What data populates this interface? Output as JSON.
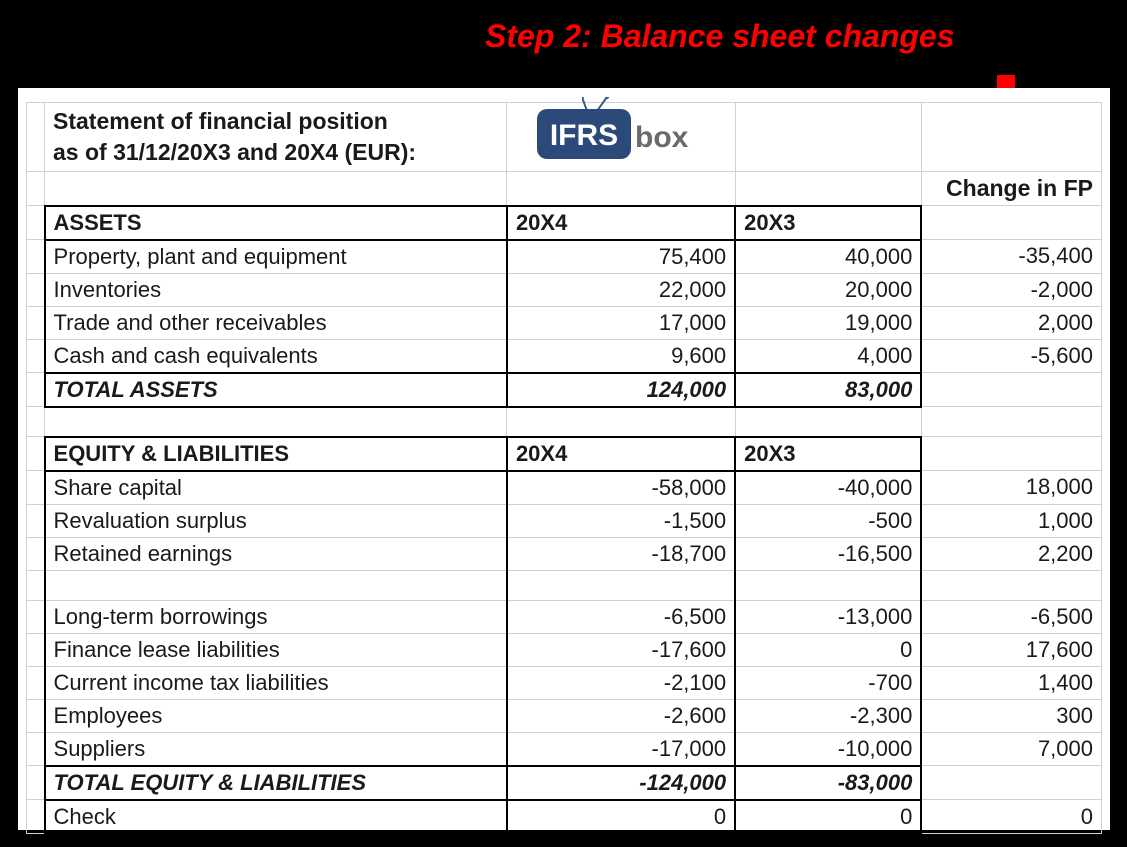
{
  "stepTitle": "Step 2: Balance sheet changes",
  "statementTitle1": "Statement of financial position",
  "statementTitle2": " as of 31/12/20X3 and 20X4 (EUR):",
  "changeHeader": "Change in FP",
  "logo": {
    "ifrs": "IFRS",
    "box": "box"
  },
  "headers": {
    "assets": "ASSETS",
    "y4": "20X4",
    "y3": "20X3",
    "equityLiab": "EQUITY & LIABILITIES"
  },
  "rows": {
    "ppe": {
      "label": "Property, plant and equipment",
      "y4": "75,400",
      "y3": "40,000",
      "change": "-35,400"
    },
    "inventories": {
      "label": "Inventories",
      "y4": "22,000",
      "y3": "20,000",
      "change": "-2,000"
    },
    "receivables": {
      "label": "Trade and other receivables",
      "y4": "17,000",
      "y3": "19,000",
      "change": "2,000"
    },
    "cash": {
      "label": "Cash and cash equivalents",
      "y4": "9,600",
      "y3": "4,000",
      "change": "-5,600"
    },
    "totalAssets": {
      "label": "TOTAL ASSETS",
      "y4": "124,000",
      "y3": "83,000",
      "change": ""
    },
    "shareCap": {
      "label": "Share capital",
      "y4": "-58,000",
      "y3": "-40,000",
      "change": "18,000"
    },
    "revalSurplus": {
      "label": "Revaluation surplus",
      "y4": "-1,500",
      "y3": "-500",
      "change": "1,000"
    },
    "retEarnings": {
      "label": "Retained earnings",
      "y4": "-18,700",
      "y3": "-16,500",
      "change": "2,200"
    },
    "ltBorrow": {
      "label": "Long-term borrowings",
      "y4": "-6,500",
      "y3": "-13,000",
      "change": "-6,500"
    },
    "finLease": {
      "label": "Finance lease liabilities",
      "y4": "-17,600",
      "y3": "0",
      "change": "17,600"
    },
    "incTax": {
      "label": "Current income tax liabilities",
      "y4": "-2,100",
      "y3": "-700",
      "change": "1,400"
    },
    "employees": {
      "label": "Employees",
      "y4": "-2,600",
      "y3": "-2,300",
      "change": "300"
    },
    "suppliers": {
      "label": "Suppliers",
      "y4": "-17,000",
      "y3": "-10,000",
      "change": "7,000"
    },
    "totalEqLiab": {
      "label": "TOTAL EQUITY & LIABILITIES",
      "y4": "-124,000",
      "y3": "-83,000",
      "change": ""
    },
    "check": {
      "label": "Check",
      "y4": "0",
      "y3": "0",
      "change": "0"
    }
  }
}
